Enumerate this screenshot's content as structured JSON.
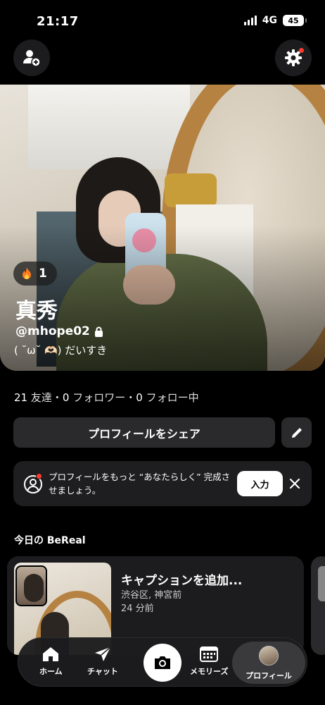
{
  "status_bar": {
    "time": "21:17",
    "network": "4G",
    "battery": "45"
  },
  "profile": {
    "streak_count": "1",
    "name": "真秀",
    "handle": "@mhope02",
    "bio": "( ˘ω˘ 🫶🏻) だいすき"
  },
  "stats": {
    "friends_count": "21",
    "friends_label": "友達",
    "followers_count": "0",
    "followers_label": "フォロワー",
    "following_count": "0",
    "following_label": "フォロー中",
    "separator": "・"
  },
  "actions": {
    "share_profile": "プロフィールをシェア"
  },
  "complete_card": {
    "text": "プロフィールをもっと “あなたらしく” 完成させましょう。",
    "input_button": "入力"
  },
  "today": {
    "section_title": "今日の BeReal",
    "caption": "キャプションを追加...",
    "location": "渋谷区, 神宮前",
    "time_ago": "24 分前"
  },
  "nav": {
    "home": "ホーム",
    "chat": "チャット",
    "memories": "メモリーズ",
    "profile": "プロフィール"
  },
  "colors": {
    "background": "#000000",
    "surface": "#1c1c1e",
    "notification_dot": "#ff3b30",
    "accent_white": "#ffffff"
  }
}
